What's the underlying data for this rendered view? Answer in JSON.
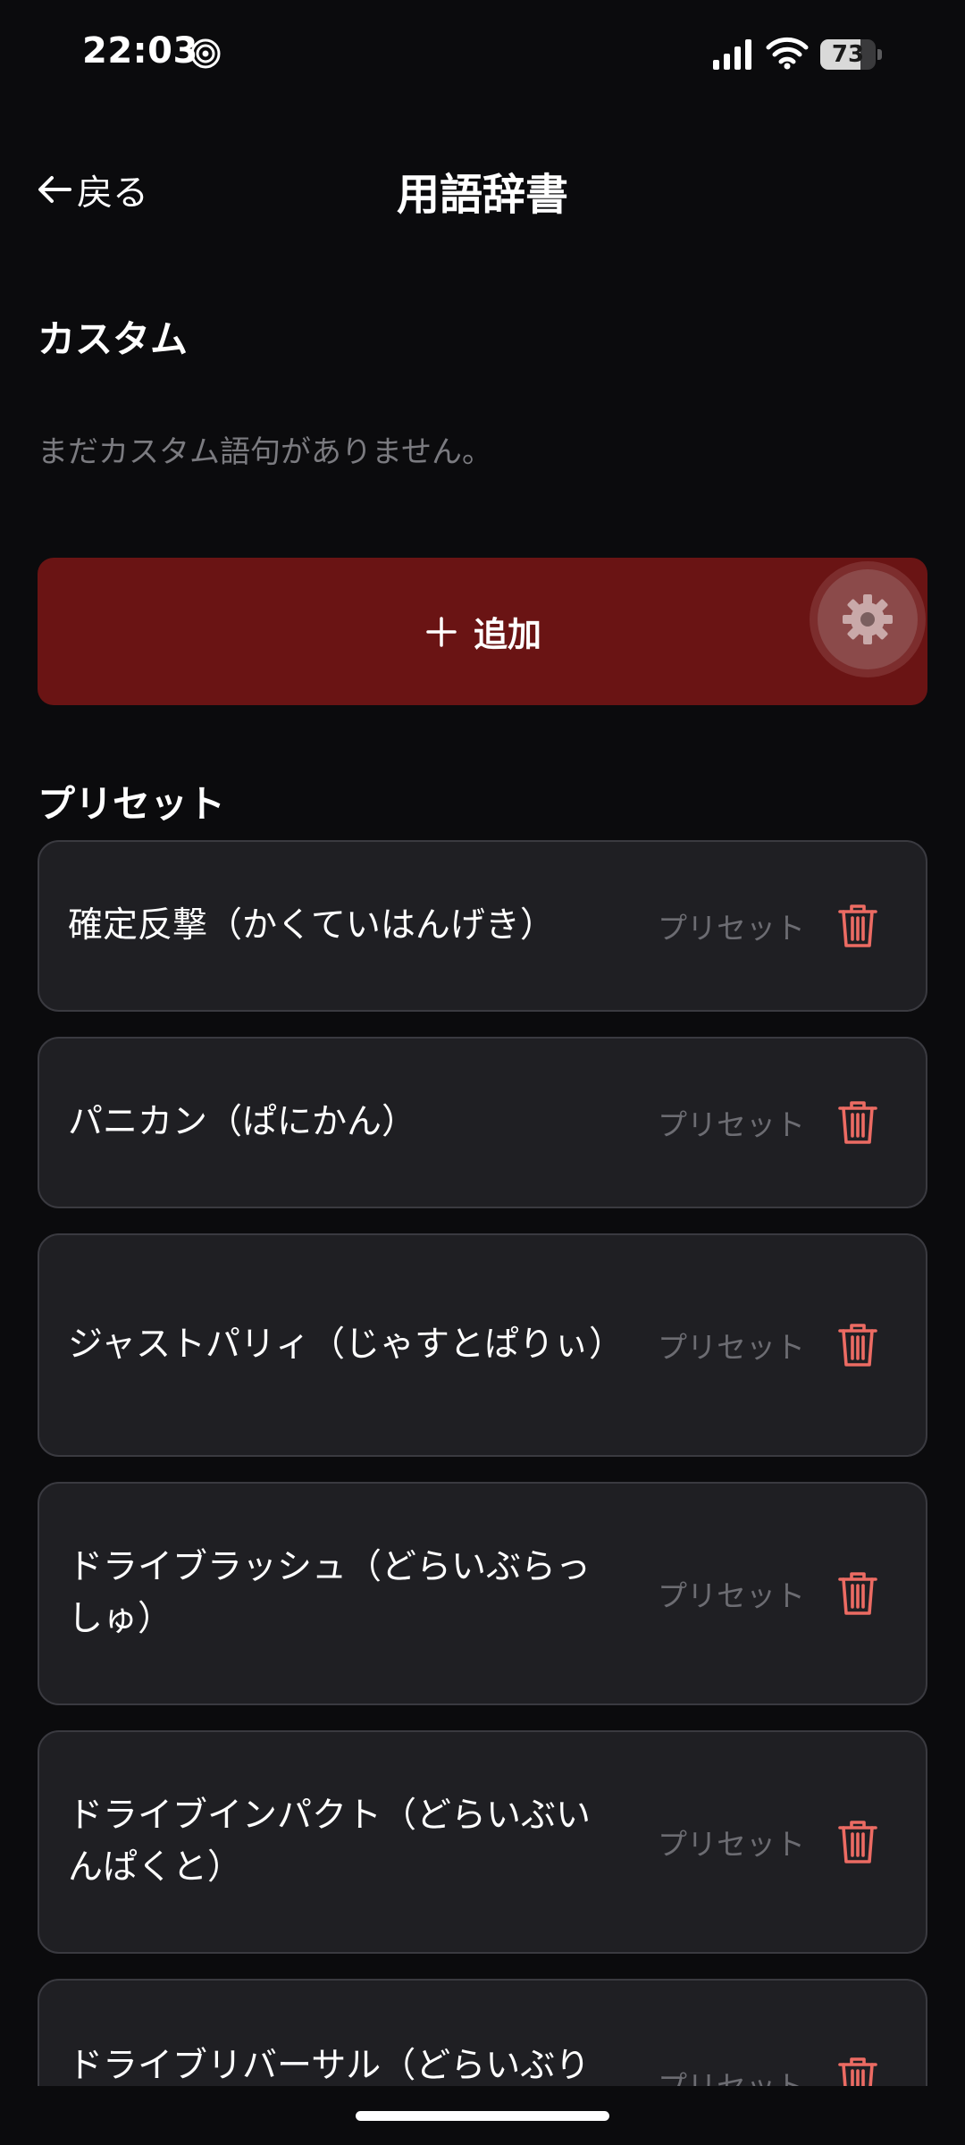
{
  "status_bar": {
    "time": "22:03",
    "battery_level": "73",
    "battery_fraction": 0.73,
    "icons": [
      "focus-icon",
      "signal-icon",
      "wifi-icon",
      "battery-icon"
    ]
  },
  "nav": {
    "back_label": "戻る",
    "title": "用語辞書"
  },
  "custom_section": {
    "title": "カスタム",
    "empty_text": "まだカスタム語句がありません。",
    "add_button_label": "追加"
  },
  "preset_section": {
    "title": "プリセット",
    "items": [
      {
        "term": "確定反撃（かくていはんげき）",
        "tag": "プリセット"
      },
      {
        "term": "パニカン（ぱにかん）",
        "tag": "プリセット"
      },
      {
        "term": "ジャストパリィ（じゃすとぱりぃ）",
        "tag": "プリセット"
      },
      {
        "term": "ドライブラッシュ（どらいぶらっしゅ）",
        "tag": "プリセット"
      },
      {
        "term": "ドライブインパクト（どらいぶいんぱくと）",
        "tag": "プリセット"
      },
      {
        "term": "ドライブリバーサル（どらいぶり",
        "tag": "プリセット"
      }
    ]
  },
  "colors": {
    "background": "#0b0b0d",
    "card": "#1f1f23",
    "accent_button": "#6a1414",
    "trash": "#ec6b63",
    "muted_text": "#7b7b80"
  }
}
